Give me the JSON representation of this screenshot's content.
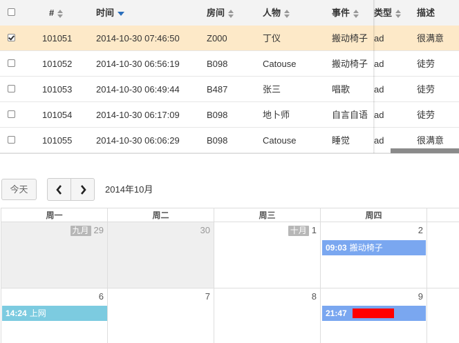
{
  "table": {
    "headers": {
      "id": "#",
      "time": "时间",
      "room": "房间",
      "person": "人物",
      "event": "事件",
      "type": "类型",
      "desc": "描述"
    },
    "rows": [
      {
        "id": "101051",
        "time": "2014-10-30 07:46:50",
        "room": "Z000",
        "person": "丁仪",
        "event": "搬动椅子",
        "type": "ad",
        "desc": "很满意",
        "checked": true
      },
      {
        "id": "101052",
        "time": "2014-10-30 06:56:19",
        "room": "B098",
        "person": "Catouse",
        "event": "搬动椅子",
        "type": "ad",
        "desc": "徒劳",
        "checked": false
      },
      {
        "id": "101053",
        "time": "2014-10-30 06:49:44",
        "room": "B487",
        "person": "张三",
        "event": "唱歌",
        "type": "ad",
        "desc": "徒劳",
        "checked": false
      },
      {
        "id": "101054",
        "time": "2014-10-30 06:17:09",
        "room": "B098",
        "person": "地卜师",
        "event": "自言自语",
        "type": "ad",
        "desc": "徒劳",
        "checked": false
      },
      {
        "id": "101055",
        "time": "2014-10-30 06:06:29",
        "room": "B098",
        "person": "Catouse",
        "event": "睡觉",
        "type": "ad",
        "desc": "很满意",
        "checked": false
      }
    ]
  },
  "toolbar": {
    "today_label": "今天",
    "prev_icon": "chevron-left-icon",
    "next_icon": "chevron-right-icon",
    "month_title": "2014年10月"
  },
  "calendar": {
    "weekdays": [
      "周一",
      "周二",
      "周三",
      "周四"
    ],
    "week1": [
      {
        "day": "29",
        "tag": "九月",
        "other": true
      },
      {
        "day": "30",
        "tag": "",
        "other": true
      },
      {
        "day": "1",
        "tag": "十月",
        "other": false
      },
      {
        "day": "2",
        "tag": "",
        "other": false
      }
    ],
    "week2": [
      {
        "day": "6"
      },
      {
        "day": "7"
      },
      {
        "day": "8"
      },
      {
        "day": "9"
      }
    ],
    "events": {
      "e1": {
        "time": "09:03",
        "title": "搬动椅子",
        "color": "#7aa7f0"
      },
      "e2": {
        "time": "14:24",
        "title": "上网",
        "color": "#7ccbe0"
      },
      "e3": {
        "time": "21:47",
        "title": "",
        "color": "#7aa7f0"
      }
    }
  },
  "colors": {
    "selected_row": "#fde9c8",
    "sort_active": "#2a6ebb",
    "redaction": "#ff0000"
  }
}
